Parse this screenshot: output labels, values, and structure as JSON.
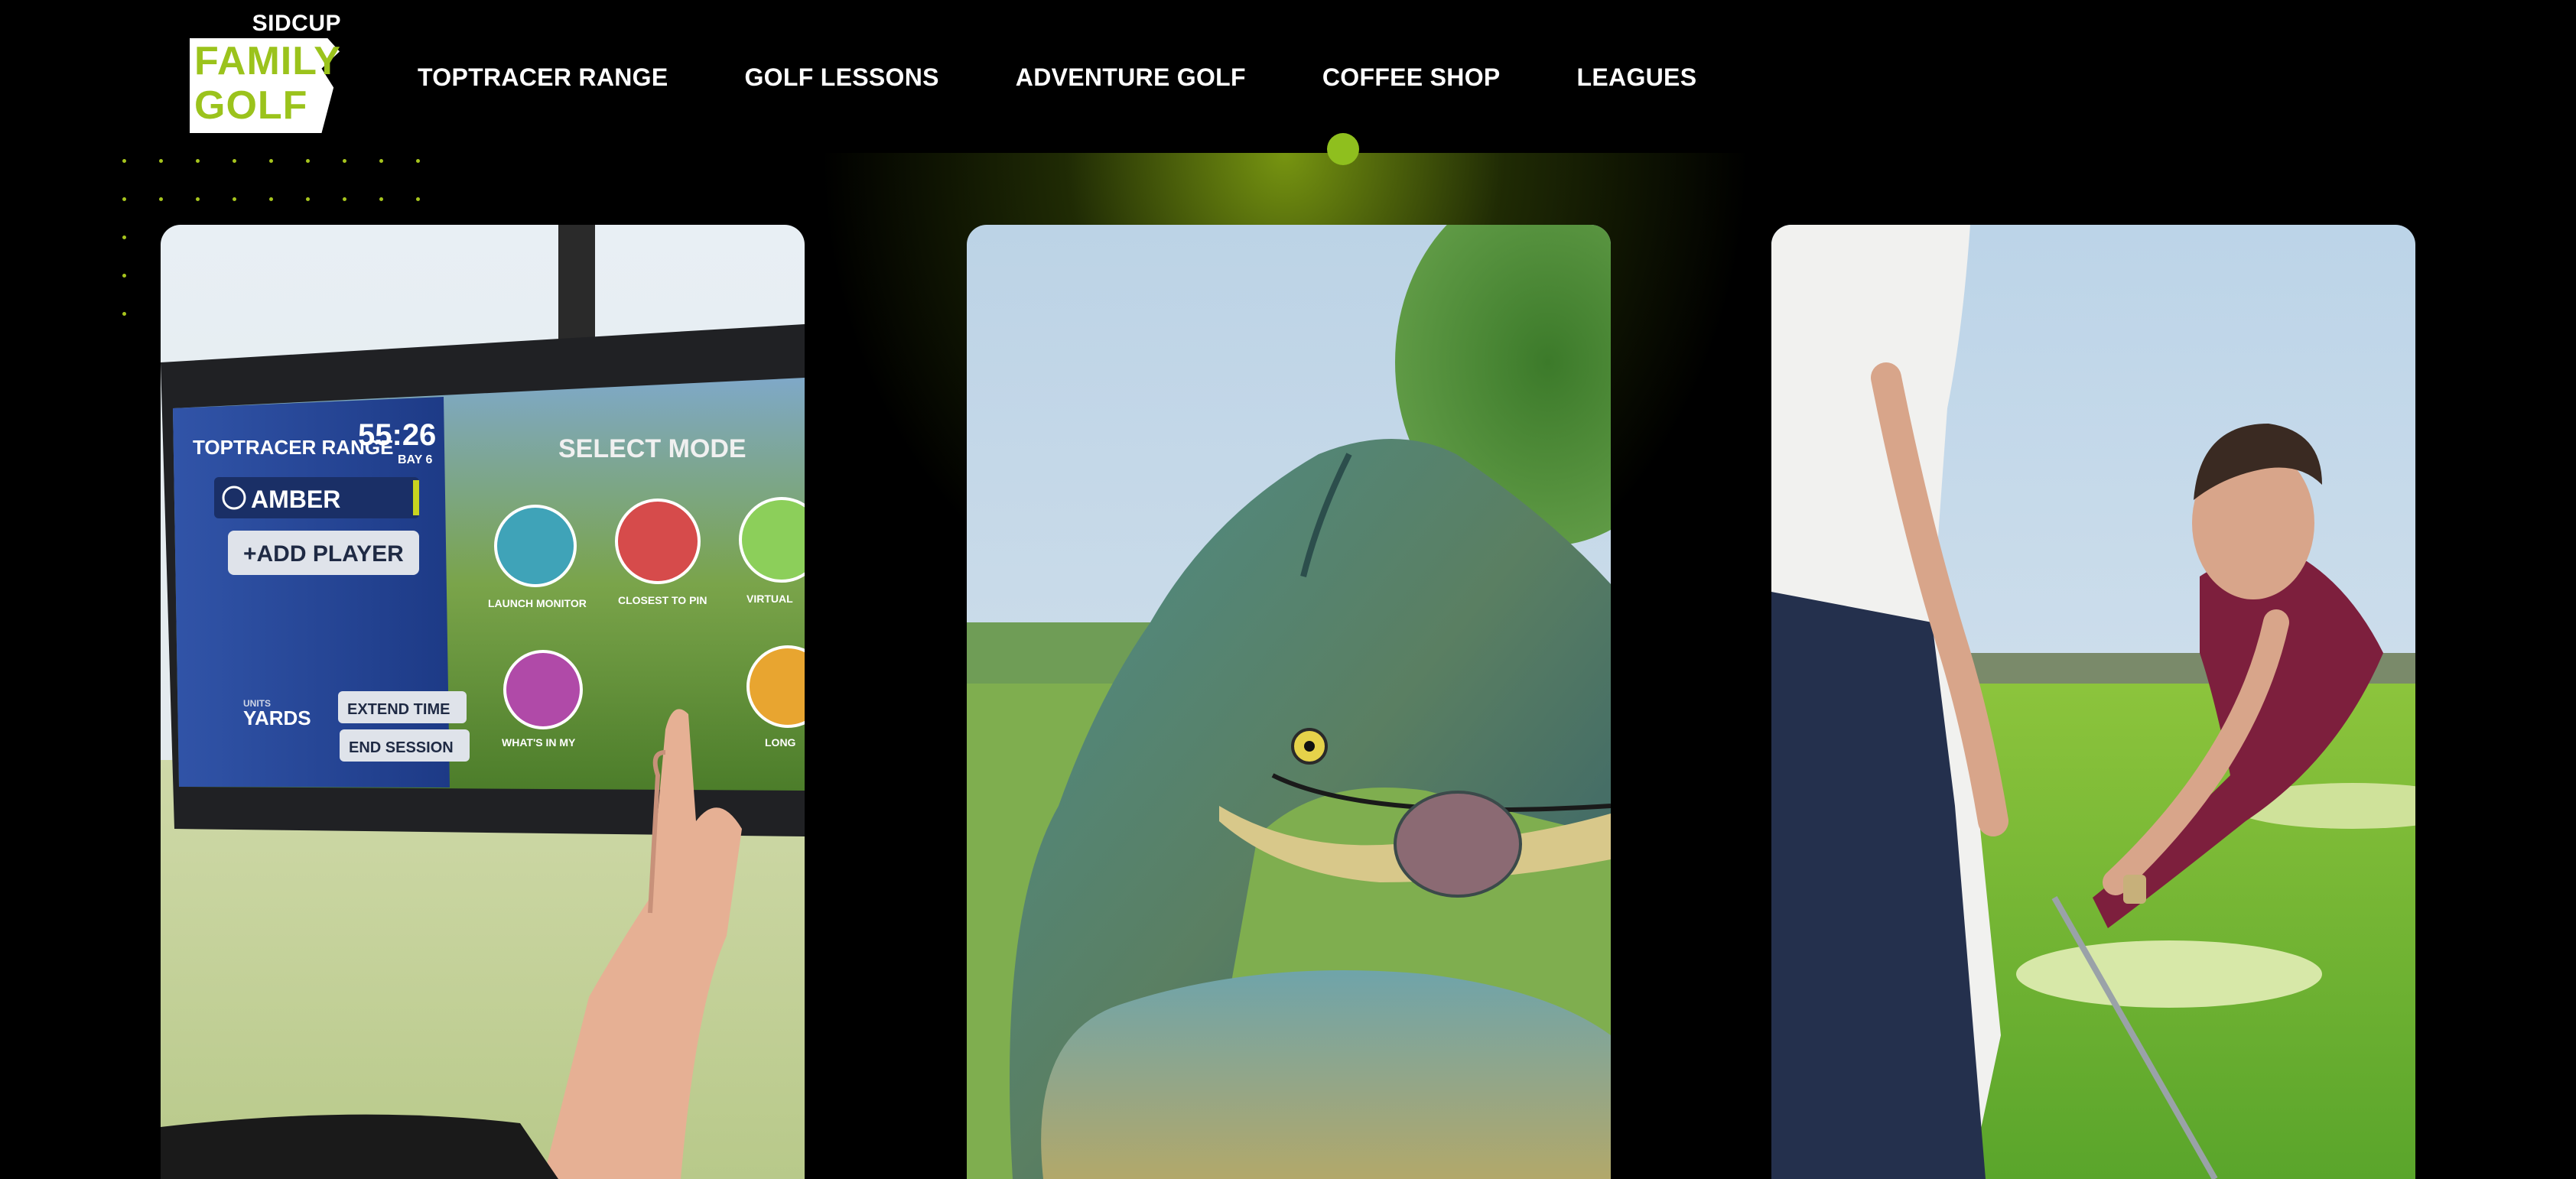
{
  "brand": {
    "top": "SIDCUP",
    "line1": "FAMILY",
    "line2": "GOLF",
    "accent": "#9bc31c"
  },
  "nav": {
    "items": [
      "TOPTRACER RANGE",
      "GOLF LESSONS",
      "ADVENTURE GOLF",
      "COFFEE SHOP",
      "LEAGUES"
    ],
    "active_index": 3
  },
  "cards": [
    {
      "name": "toptracer-screen",
      "screen": {
        "brand": "TOPTRACER RANGE",
        "timer": "55:26",
        "bay": "BAY 6",
        "title": "SELECT MODE",
        "player": "AMBER",
        "add_player": "+ADD PLAYER",
        "units_label": "UNITS",
        "units": "YARDS",
        "extend": "EXTEND TIME",
        "end": "END SESSION",
        "modes": [
          "LAUNCH MONITOR",
          "CLOSEST TO PIN",
          "VIRTUAL",
          "WHAT'S IN MY",
          "LONG"
        ]
      }
    },
    {
      "name": "dinosaur-photo"
    },
    {
      "name": "golf-lesson-photo"
    }
  ],
  "colors": {
    "background": "#000000",
    "accent": "#8fbf1e",
    "nav_text": "#ffffff"
  }
}
